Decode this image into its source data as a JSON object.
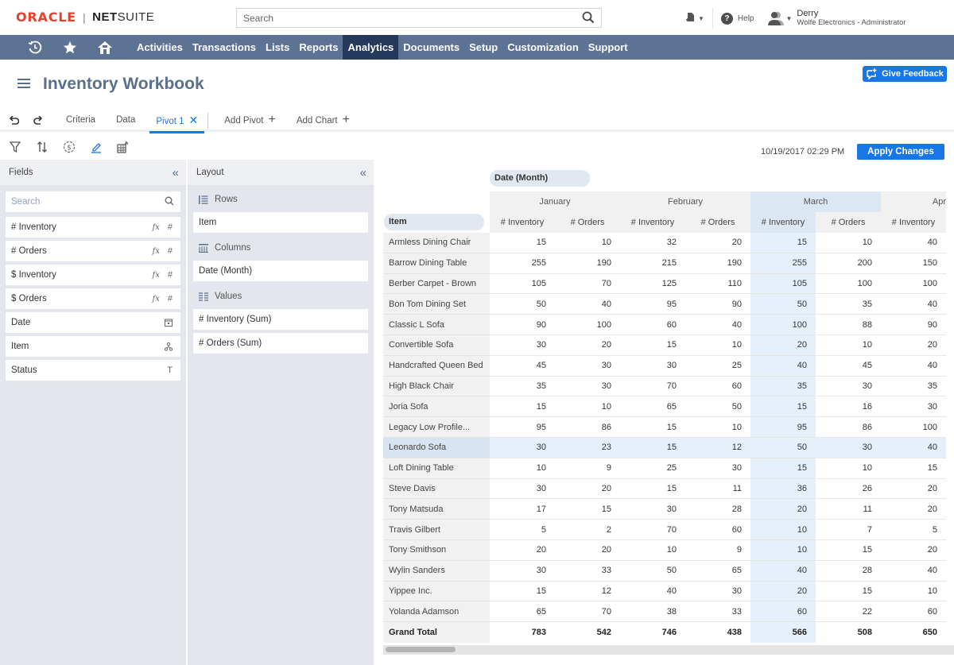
{
  "header": {
    "logo_oracle": "ORACLE",
    "logo_separator": "|",
    "logo_net": "NET",
    "logo_suite": "SUITE",
    "search_placeholder": "Search",
    "help_label": "Help",
    "user_name": "Derry",
    "user_role": "Wolfe Electronics - Administrator"
  },
  "nav": {
    "icons": [
      "recent-records-icon",
      "star-icon",
      "home-icon"
    ],
    "items": [
      {
        "label": "Activities",
        "active": false
      },
      {
        "label": "Transactions",
        "active": false
      },
      {
        "label": "Lists",
        "active": false
      },
      {
        "label": "Reports",
        "active": false
      },
      {
        "label": "Analytics",
        "active": true
      },
      {
        "label": "Documents",
        "active": false
      },
      {
        "label": "Setup",
        "active": false
      },
      {
        "label": "Customization",
        "active": false
      },
      {
        "label": "Support",
        "active": false
      }
    ]
  },
  "page": {
    "title": "Inventory Workbook",
    "feedback_label": "Give Feedback"
  },
  "tabs": {
    "items": [
      {
        "label": "Criteria",
        "active": false
      },
      {
        "label": "Data",
        "active": false
      },
      {
        "label": "Pivot 1",
        "active": true
      }
    ],
    "add_pivot": "Add Pivot",
    "add_chart": "Add Chart"
  },
  "toolbar": {
    "timestamp": "10/19/2017 02:29 PM",
    "apply_label": "Apply Changes",
    "tools": [
      "filter-icon",
      "sort-icon",
      "currency-icon",
      "edit-icon",
      "chart-settings-icon"
    ]
  },
  "fields_panel": {
    "title": "Fields",
    "search_placeholder": "Search",
    "items": [
      {
        "label": "# Inventory",
        "type": "number",
        "formula": true
      },
      {
        "label": "# Orders",
        "type": "number",
        "formula": true
      },
      {
        "label": "$ Inventory",
        "type": "number",
        "formula": true
      },
      {
        "label": "$ Orders",
        "type": "number",
        "formula": true
      },
      {
        "label": "Date",
        "type": "date",
        "formula": false
      },
      {
        "label": "Item",
        "type": "record",
        "formula": false
      },
      {
        "label": "Status",
        "type": "text",
        "formula": false
      }
    ]
  },
  "layout_panel": {
    "title": "Layout",
    "rows_label": "Rows",
    "rows": [
      "Item"
    ],
    "columns_label": "Columns",
    "columns": [
      "Date (Month)"
    ],
    "values_label": "Values",
    "values": [
      "# Inventory (Sum)",
      "# Orders (Sum)"
    ]
  },
  "pivot": {
    "column_field": "Date (Month)",
    "row_field": "Item",
    "months": [
      {
        "label": "January",
        "highlighted": false
      },
      {
        "label": "February",
        "highlighted": false
      },
      {
        "label": "March",
        "highlighted": true
      },
      {
        "label": "Apr",
        "highlighted": false
      }
    ],
    "measures": [
      "# Inventory",
      "# Orders"
    ],
    "selected_row": "Leonardo Sofa",
    "rows": [
      {
        "item": "Armless Dining Chair",
        "values": [
          15,
          10,
          32,
          20,
          15,
          10,
          40
        ]
      },
      {
        "item": "Barrow Dining Table",
        "values": [
          255,
          190,
          215,
          190,
          255,
          200,
          150
        ]
      },
      {
        "item": "Berber Carpet - Brown",
        "values": [
          105,
          70,
          125,
          110,
          105,
          100,
          100
        ]
      },
      {
        "item": "Bon Tom Dining Set",
        "values": [
          50,
          40,
          95,
          90,
          50,
          35,
          40
        ]
      },
      {
        "item": "Classic L Sofa",
        "values": [
          90,
          100,
          60,
          40,
          100,
          88,
          90
        ]
      },
      {
        "item": "Convertible Sofa",
        "values": [
          30,
          20,
          15,
          10,
          20,
          10,
          20
        ]
      },
      {
        "item": "Handcrafted Queen Bed",
        "values": [
          45,
          30,
          30,
          25,
          40,
          45,
          40
        ]
      },
      {
        "item": "High Black Chair",
        "values": [
          35,
          30,
          70,
          60,
          35,
          30,
          35
        ]
      },
      {
        "item": "Joria Sofa",
        "values": [
          15,
          10,
          65,
          50,
          15,
          16,
          30
        ]
      },
      {
        "item": "Legacy Low Profile...",
        "values": [
          95,
          86,
          15,
          10,
          95,
          86,
          100
        ]
      },
      {
        "item": "Leonardo Sofa",
        "values": [
          30,
          23,
          15,
          12,
          50,
          30,
          40
        ]
      },
      {
        "item": "Loft Dining Table",
        "values": [
          10,
          9,
          25,
          30,
          15,
          10,
          15
        ]
      },
      {
        "item": "Steve Davis",
        "values": [
          30,
          20,
          15,
          11,
          36,
          26,
          20
        ]
      },
      {
        "item": "Tony Matsuda",
        "values": [
          17,
          15,
          30,
          28,
          20,
          11,
          20
        ]
      },
      {
        "item": "Travis Gilbert",
        "values": [
          5,
          2,
          70,
          60,
          10,
          7,
          5
        ]
      },
      {
        "item": "Tony Smithson",
        "values": [
          20,
          20,
          10,
          9,
          10,
          15,
          20
        ]
      },
      {
        "item": "Wylin Sanders",
        "values": [
          30,
          33,
          50,
          65,
          40,
          28,
          40
        ]
      },
      {
        "item": "Yippee Inc.",
        "values": [
          15,
          12,
          40,
          30,
          20,
          15,
          10
        ]
      },
      {
        "item": "Yolanda Adamson",
        "values": [
          65,
          70,
          38,
          33,
          60,
          22,
          60
        ]
      }
    ],
    "grand_total": {
      "label": "Grand Total",
      "values": [
        783,
        542,
        746,
        438,
        566,
        508,
        650
      ]
    }
  }
}
